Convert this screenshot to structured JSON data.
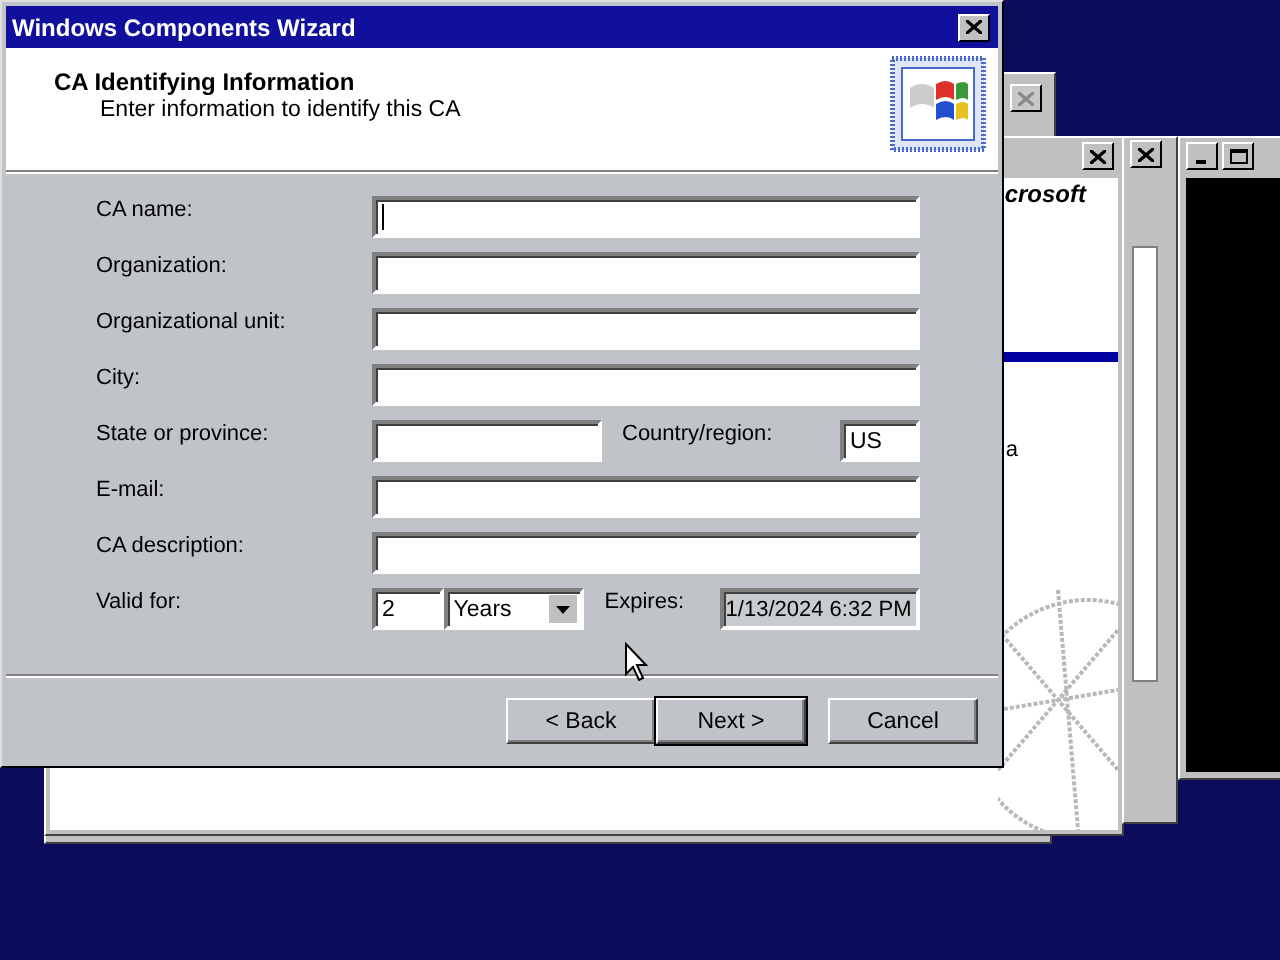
{
  "background": {
    "logo_fragment": "crosoft",
    "text_fragment": "a"
  },
  "window": {
    "title": "Windows Components Wizard"
  },
  "header": {
    "title": "CA Identifying Information",
    "subtitle": "Enter information to identify this CA"
  },
  "fields": [
    {
      "kind": "text",
      "label": "CA name:",
      "focused": true
    },
    {
      "kind": "text",
      "label": "Organization:",
      "focused": false
    },
    {
      "kind": "text",
      "label": "Organizational unit:",
      "focused": false
    },
    {
      "kind": "text",
      "label": "City:",
      "focused": false
    },
    {
      "kind": "state",
      "label": "State or province:",
      "focused": false,
      "country_label": "Country/region:",
      "country_value": "US"
    },
    {
      "kind": "text",
      "label": "E-mail:",
      "focused": false
    },
    {
      "kind": "text",
      "label": "CA description:",
      "focused": false
    },
    {
      "kind": "validity",
      "label": "Valid for:",
      "count": "2",
      "unit": "Years",
      "expires_label": "Expires:",
      "expires": "1/13/2024 6:32 PM"
    }
  ],
  "buttons": [
    {
      "label": "< Back",
      "default": false
    },
    {
      "label": "Next >",
      "default": true
    },
    {
      "label": "Cancel",
      "default": false
    }
  ]
}
